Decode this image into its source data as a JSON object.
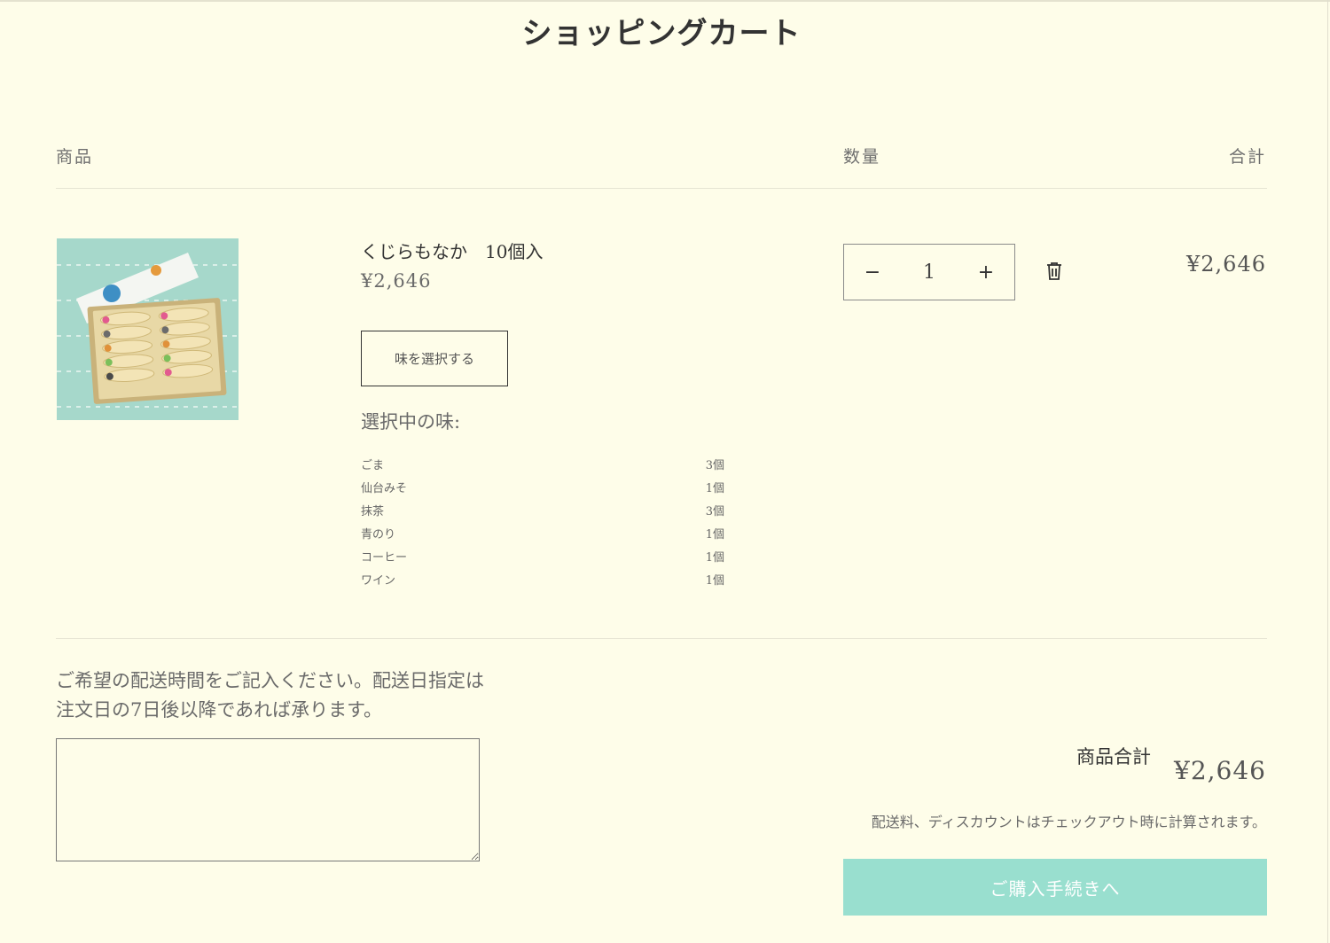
{
  "page": {
    "title": "ショッピングカート"
  },
  "table_headers": {
    "product": "商品",
    "quantity": "数量",
    "total": "合計"
  },
  "cart_item": {
    "name": "くじらもなか　10個入",
    "price": "¥2,646",
    "flavor_button": "味を選択する",
    "selected_flavors_title": "選択中の味:",
    "flavors": [
      {
        "name": "ごま",
        "count": "3個"
      },
      {
        "name": "仙台みそ",
        "count": "1個"
      },
      {
        "name": "抹茶",
        "count": "3個"
      },
      {
        "name": "青のり",
        "count": "1個"
      },
      {
        "name": "コーヒー",
        "count": "1個"
      },
      {
        "name": "ワイン",
        "count": "1個"
      }
    ],
    "quantity": "1",
    "decrement_symbol": "−",
    "increment_symbol": "+",
    "line_total": "¥2,646"
  },
  "note": {
    "label": "ご希望の配送時間をご記入ください。配送日指定は注文日の7日後以降であれば承ります。",
    "value": ""
  },
  "summary": {
    "subtotal_label": "商品合計",
    "subtotal_value": "¥2,646",
    "shipping_note": "配送料、ディスカウントはチェックアウト時に計算されます。",
    "checkout_label": "ご購入手続きへ"
  },
  "colors": {
    "background": "#fefde9",
    "checkout_button": "#99dfcf",
    "image_background": "#a8d9cc"
  }
}
